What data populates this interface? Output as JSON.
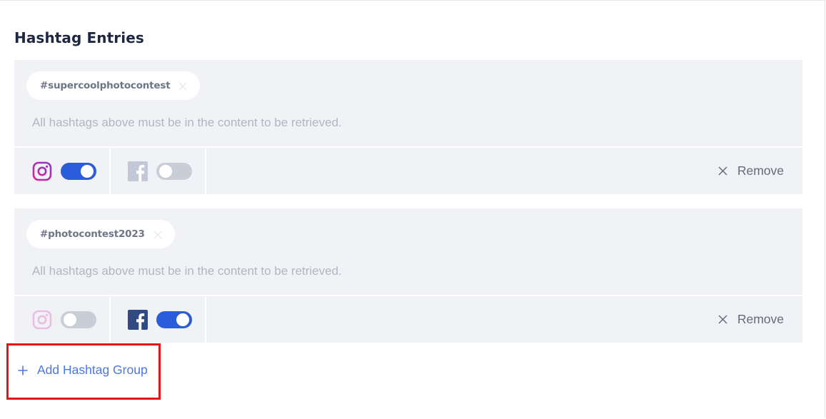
{
  "section": {
    "title": "Hashtag Entries"
  },
  "groups": [
    {
      "hashtag": "#supercoolphotocontest",
      "hint": "All hashtags above must be in the content to be retrieved.",
      "instagram_enabled": true,
      "facebook_enabled": false,
      "remove_label": "Remove"
    },
    {
      "hashtag": "#photocontest2023",
      "hint": "All hashtags above must be in the content to be retrieved.",
      "instagram_enabled": false,
      "facebook_enabled": true,
      "remove_label": "Remove"
    }
  ],
  "add_group": {
    "label": "Add Hashtag Group"
  },
  "colors": {
    "toggle_on": "#2b5cd9",
    "toggle_off": "#c9cdd6",
    "group_bg": "#f0f2f5",
    "link": "#4b76e6",
    "highlight": "#ee1111"
  },
  "icons": {
    "instagram": "instagram-icon",
    "facebook": "facebook-icon",
    "remove": "close-icon",
    "add": "plus-icon"
  }
}
